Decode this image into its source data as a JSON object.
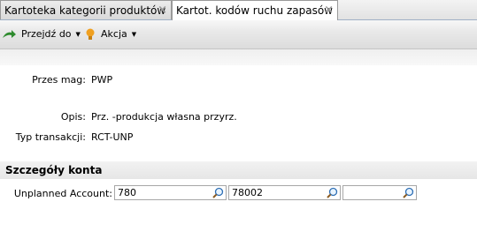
{
  "tabs": [
    {
      "label": "Kartoteka kategorii produktów",
      "close": "×"
    },
    {
      "label": "Kartot. kodów ruchu zapasów",
      "close": "×"
    }
  ],
  "toolbar": {
    "goto_label": "Przejdź do",
    "goto_icon": "green-arrow-icon",
    "action_label": "Akcja",
    "action_icon": "lightbulb-icon"
  },
  "form": {
    "przes_mag": {
      "label": "Przes mag:",
      "value": "PWP"
    },
    "opis": {
      "label": "Opis:",
      "value": "Prz. -produkcja własna przyrz."
    },
    "typ_transakcji": {
      "label": "Typ transakcji:",
      "value": "RCT-UNP"
    }
  },
  "section": {
    "title": "Szczegóły konta"
  },
  "account": {
    "label": "Unplanned Account:",
    "segments": [
      "780",
      "78002",
      ""
    ],
    "lookup_icon": "magnifier-icon"
  },
  "colors": {
    "tab_border": "#9a9a9a",
    "section_bg": "#eaeaea",
    "arrow_green": "#2e8b2e",
    "bulb_orange": "#f0a020"
  }
}
